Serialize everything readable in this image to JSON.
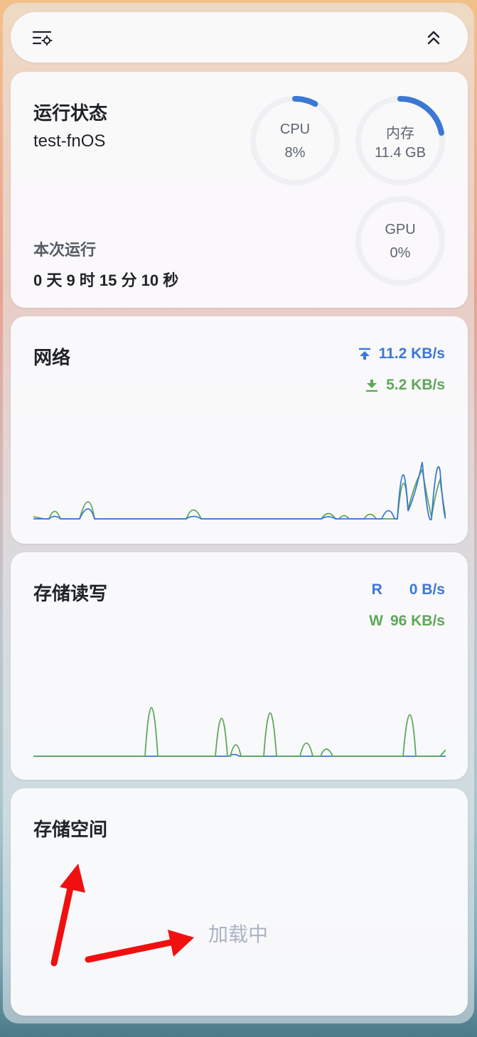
{
  "toolbar": {
    "settings_icon": "list-settings-icon",
    "collapse_icon": "chevrons-up-icon"
  },
  "status": {
    "title": "运行状态",
    "hostname": "test-fnOS",
    "uptime_label": "本次运行",
    "uptime_value": "0 天 9 时 15 分 10 秒",
    "gauges": {
      "cpu": {
        "label": "CPU",
        "value": "8%",
        "fraction": 0.08
      },
      "memory": {
        "label": "内存",
        "value": "11.4 GB",
        "fraction": 0.22
      },
      "gpu": {
        "label": "GPU",
        "value": "0%",
        "fraction": 0
      }
    },
    "colors": {
      "accent": "#3a78d4",
      "track": "#eef0f3"
    }
  },
  "network": {
    "title": "网络",
    "upload": "11.2 KB/s",
    "download": "5.2 KB/s",
    "upload_icon": "upload-arrow-icon",
    "download_icon": "download-arrow-icon",
    "colors": {
      "upload": "#3a78d4",
      "download": "#5ea859"
    }
  },
  "storage_io": {
    "title": "存储读写",
    "read_label": "R",
    "read_value": "0 B/s",
    "write_label": "W",
    "write_value": "96 KB/s",
    "colors": {
      "read": "#3a78d4",
      "write": "#5ea859"
    }
  },
  "storage_space": {
    "title": "存储空间",
    "loading_text": "加载中",
    "annotation_color": "#f01010"
  }
}
